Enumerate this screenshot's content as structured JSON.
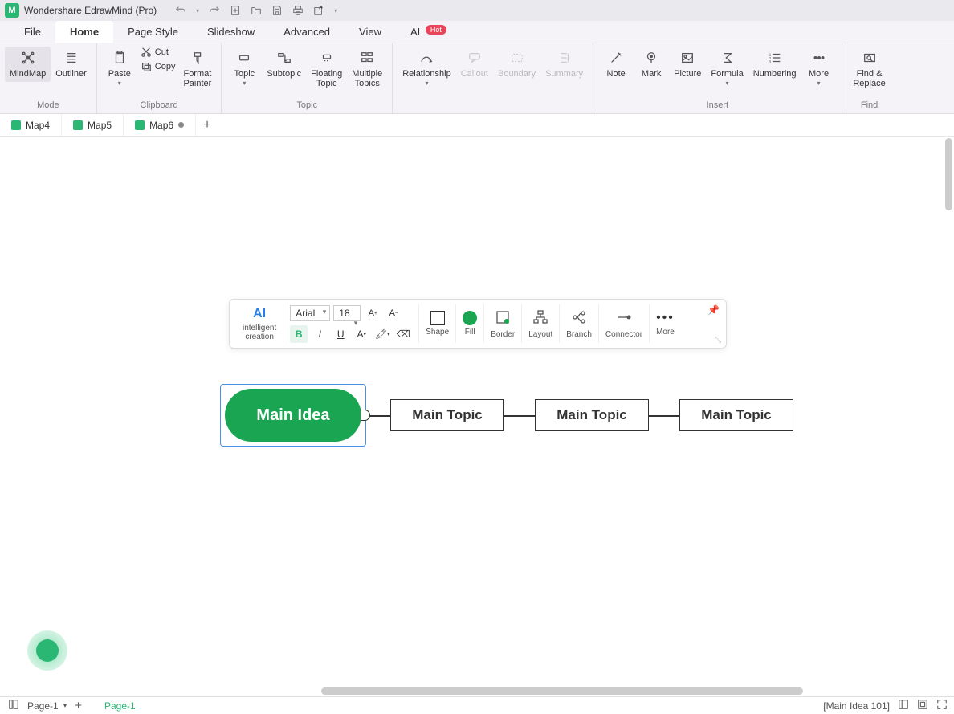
{
  "app": {
    "title": "Wondershare EdrawMind (Pro)"
  },
  "menu": {
    "items": [
      "File",
      "Home",
      "Page Style",
      "Slideshow",
      "Advanced",
      "View"
    ],
    "ai_label": "AI",
    "ai_badge": "Hot",
    "active": 1
  },
  "ribbon": {
    "mode": {
      "label": "Mode",
      "mindmap": "MindMap",
      "outliner": "Outliner"
    },
    "clipboard": {
      "label": "Clipboard",
      "paste": "Paste",
      "cut": "Cut",
      "copy": "Copy",
      "format_painter": "Format\nPainter"
    },
    "topic": {
      "label": "Topic",
      "topic": "Topic",
      "subtopic": "Subtopic",
      "floating": "Floating\nTopic",
      "multiple": "Multiple\nTopics"
    },
    "rel": {
      "relationship": "Relationship",
      "callout": "Callout",
      "boundary": "Boundary",
      "summary": "Summary"
    },
    "insert": {
      "label": "Insert",
      "note": "Note",
      "mark": "Mark",
      "picture": "Picture",
      "formula": "Formula",
      "numbering": "Numbering",
      "more": "More"
    },
    "find": {
      "label": "Find",
      "find_replace": "Find &\nReplace"
    }
  },
  "doctabs": {
    "tabs": [
      {
        "name": "Map4",
        "modified": false
      },
      {
        "name": "Map5",
        "modified": false
      },
      {
        "name": "Map6",
        "modified": true
      }
    ],
    "active": 2
  },
  "float_toolbar": {
    "ai": "AI",
    "ai_label": "intelligent\ncreation",
    "font_name": "Arial",
    "font_size": "18",
    "shape": "Shape",
    "fill": "Fill",
    "border": "Border",
    "layout": "Layout",
    "branch": "Branch",
    "connector": "Connector",
    "more": "More"
  },
  "mindmap": {
    "root": "Main Idea",
    "topics": [
      "Main Topic",
      "Main Topic",
      "Main Topic"
    ]
  },
  "statusbar": {
    "page_selector": "Page-1",
    "active_page": "Page-1",
    "selection": "[Main Idea 101]"
  },
  "colors": {
    "accent": "#1aa552"
  }
}
